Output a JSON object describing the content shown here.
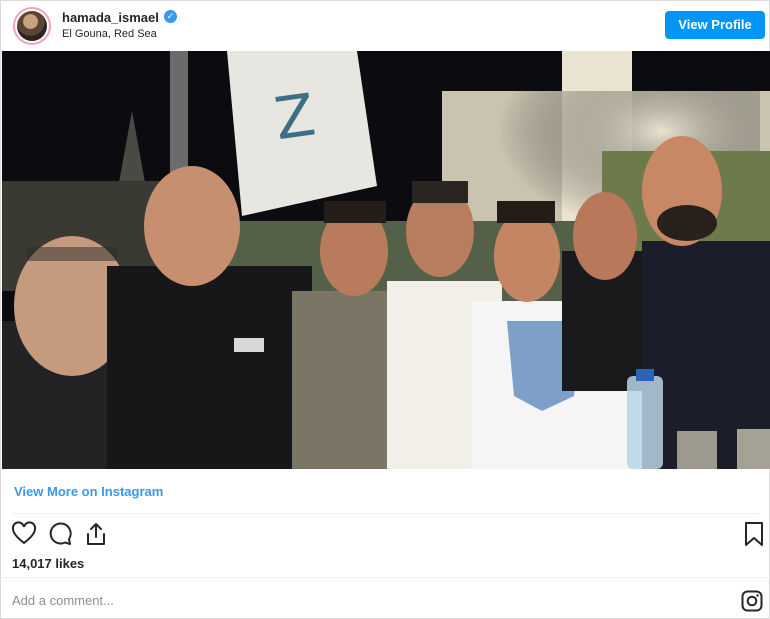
{
  "post": {
    "username": "hamada_ismael",
    "location": "El Gouna, Red Sea",
    "verified": true,
    "view_profile_label": "View Profile",
    "view_more_label": "View More on Instagram",
    "likes": "14,017 likes",
    "comment_placeholder": "Add a comment...",
    "accent_color": "#3897f0"
  },
  "icons": {
    "like": "heart-icon",
    "comment": "comment-bubble-icon",
    "share": "share-icon",
    "save": "bookmark-icon",
    "brand": "instagram-icon",
    "verified": "verified-badge-icon"
  },
  "photo": {
    "description_text": "",
    "people_count": 7
  }
}
